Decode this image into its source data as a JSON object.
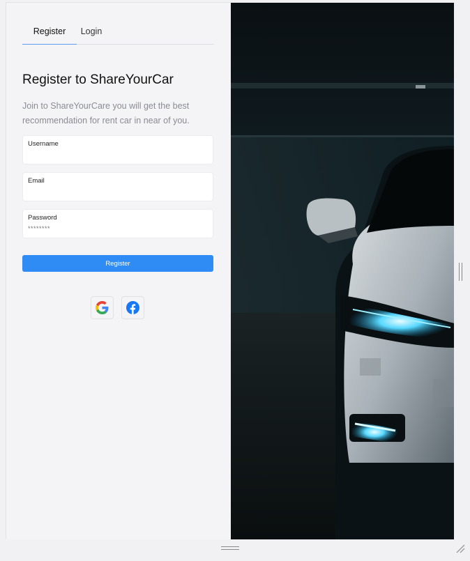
{
  "tabs": {
    "register": "Register",
    "login": "Login"
  },
  "heading": "Register to ShareYourCar",
  "description": "Join to ShareYourCare you will get the best recommendation for rent car in near of you.",
  "form": {
    "username_label": "Username",
    "username_value": "",
    "email_label": "Email",
    "email_value": "",
    "password_label": "Password",
    "password_placeholder": "********",
    "submit_label": "Register"
  },
  "social": [
    {
      "icon": "google-icon"
    },
    {
      "icon": "facebook-icon"
    }
  ],
  "colors": {
    "primary": "#2f8cf5",
    "tab_underline": "#5b9bf0",
    "background": "#f4f4f6",
    "headlight": "#3fd0ff"
  }
}
